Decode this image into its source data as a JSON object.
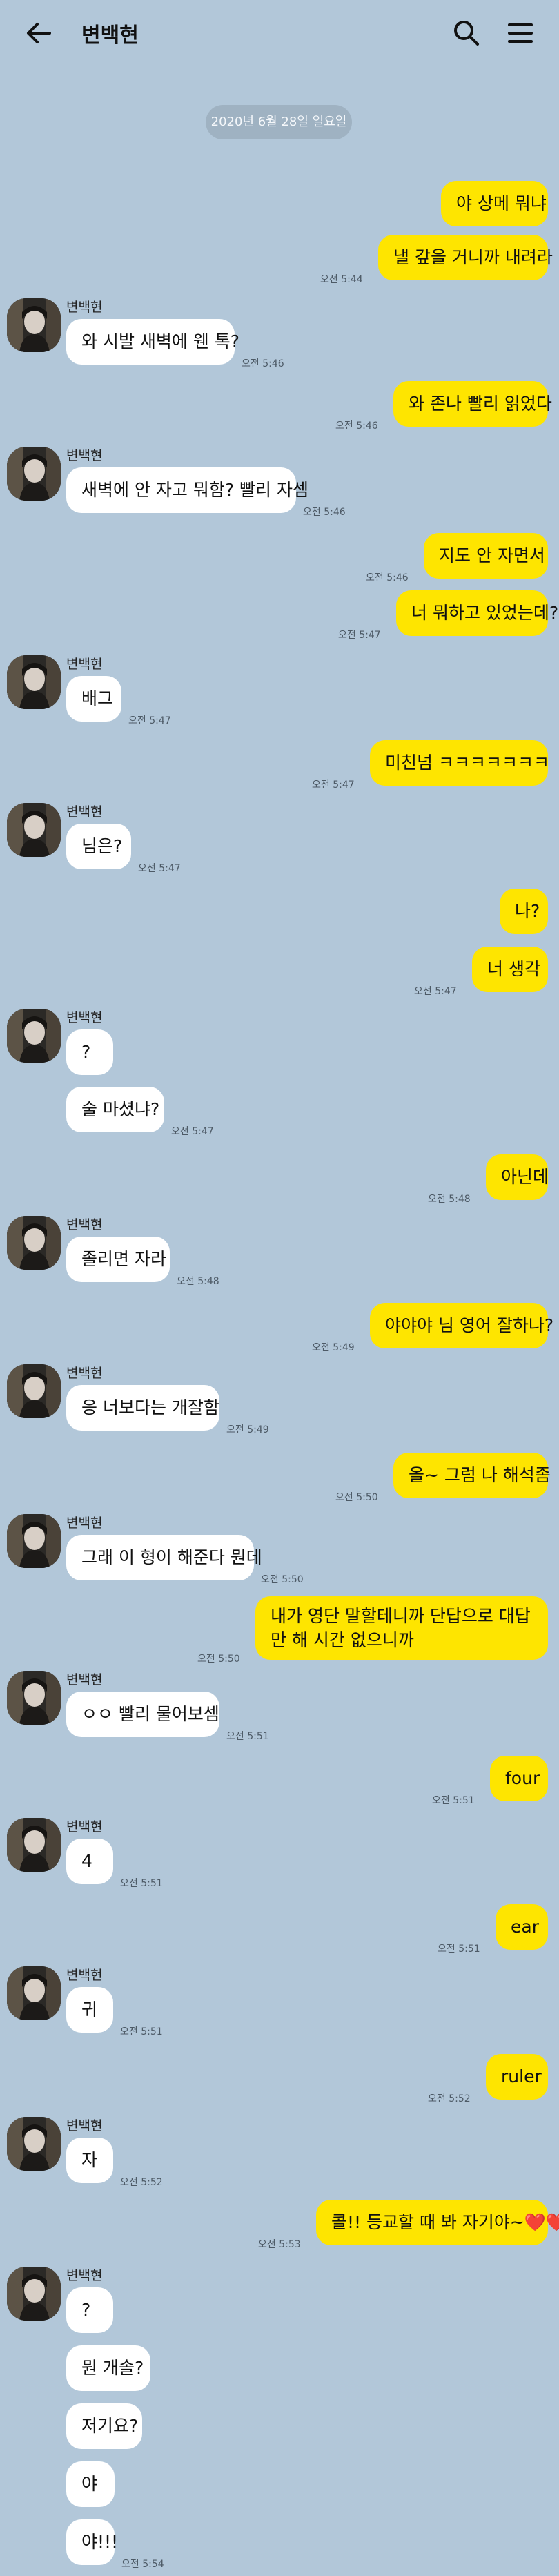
{
  "header": {
    "title": "변백현",
    "back_icon": "arrow-left-icon",
    "search_icon": "search-icon",
    "menu_icon": "hamburger-menu-icon"
  },
  "date_divider": "2020년 6월 28일 일요일",
  "sender_name": "변백현",
  "colors": {
    "background": "#b2c7d9",
    "my_bubble": "#fee500",
    "their_bubble": "#ffffff"
  },
  "messages": [
    {
      "from": "me",
      "text": "야 상메 뭐냐"
    },
    {
      "from": "me",
      "text": "낼 갚을 거니까 내려라",
      "time": "오전 5:44"
    },
    {
      "from": "them",
      "text": "와 시발 새벽에 웬 톡?",
      "time": "오전 5:46"
    },
    {
      "from": "me",
      "text": "와 존나 빨리 읽었다",
      "time": "오전 5:46"
    },
    {
      "from": "them",
      "text": "새벽에 안 자고 뭐함? 빨리 자셈",
      "time": "오전 5:46"
    },
    {
      "from": "me",
      "text": "지도 안 자면서",
      "time": "오전 5:46"
    },
    {
      "from": "me",
      "text": "너 뭐하고 있었는데?",
      "time": "오전 5:47"
    },
    {
      "from": "them",
      "text": "배그",
      "time": "오전 5:47"
    },
    {
      "from": "me",
      "text": "미친넘 ㅋㅋㅋㅋㅋㅋㅋ",
      "time": "오전 5:47"
    },
    {
      "from": "them",
      "text": "님은?",
      "time": "오전 5:47"
    },
    {
      "from": "me",
      "text": "나?"
    },
    {
      "from": "me",
      "text": "너 생각",
      "time": "오전 5:47"
    },
    {
      "from": "them",
      "text": "?"
    },
    {
      "from": "them",
      "text": "술 마셨냐?",
      "time": "오전 5:47"
    },
    {
      "from": "me",
      "text": "아닌데",
      "time": "오전 5:48"
    },
    {
      "from": "them",
      "text": "졸리면 자라",
      "time": "오전 5:48"
    },
    {
      "from": "me",
      "text": "야야야 님 영어 잘하나?",
      "time": "오전 5:49"
    },
    {
      "from": "them",
      "text": "응 너보다는 개잘함",
      "time": "오전 5:49"
    },
    {
      "from": "me",
      "text": "올~ 그럼 나 해석좀",
      "time": "오전 5:50"
    },
    {
      "from": "them",
      "text": "그래 이 형이 해준다 뭔데",
      "time": "오전 5:50"
    },
    {
      "from": "me",
      "text": "내가 영단 말할테니까 단답으로 대답만 해\n시간 없으니까",
      "time": "오전 5:50"
    },
    {
      "from": "them",
      "text": "ㅇㅇ 빨리 물어보셈",
      "time": "오전 5:51"
    },
    {
      "from": "me",
      "text": "four",
      "time": "오전 5:51"
    },
    {
      "from": "them",
      "text": "4",
      "time": "오전 5:51"
    },
    {
      "from": "me",
      "text": "ear",
      "time": "오전 5:51"
    },
    {
      "from": "them",
      "text": "귀",
      "time": "오전 5:51"
    },
    {
      "from": "me",
      "text": "ruler",
      "time": "오전 5:52"
    },
    {
      "from": "them",
      "text": "자",
      "time": "오전 5:52"
    },
    {
      "from": "me",
      "text": "콜!! 등교할 때 봐 자기야~❤️❤️",
      "time": "오전 5:53"
    },
    {
      "from": "them",
      "text": "?"
    },
    {
      "from": "them",
      "text": "뭔 개솔?"
    },
    {
      "from": "them",
      "text": "저기요?"
    },
    {
      "from": "them",
      "text": "야"
    },
    {
      "from": "them",
      "text": "야!!!",
      "time": "오전 5:54"
    }
  ]
}
